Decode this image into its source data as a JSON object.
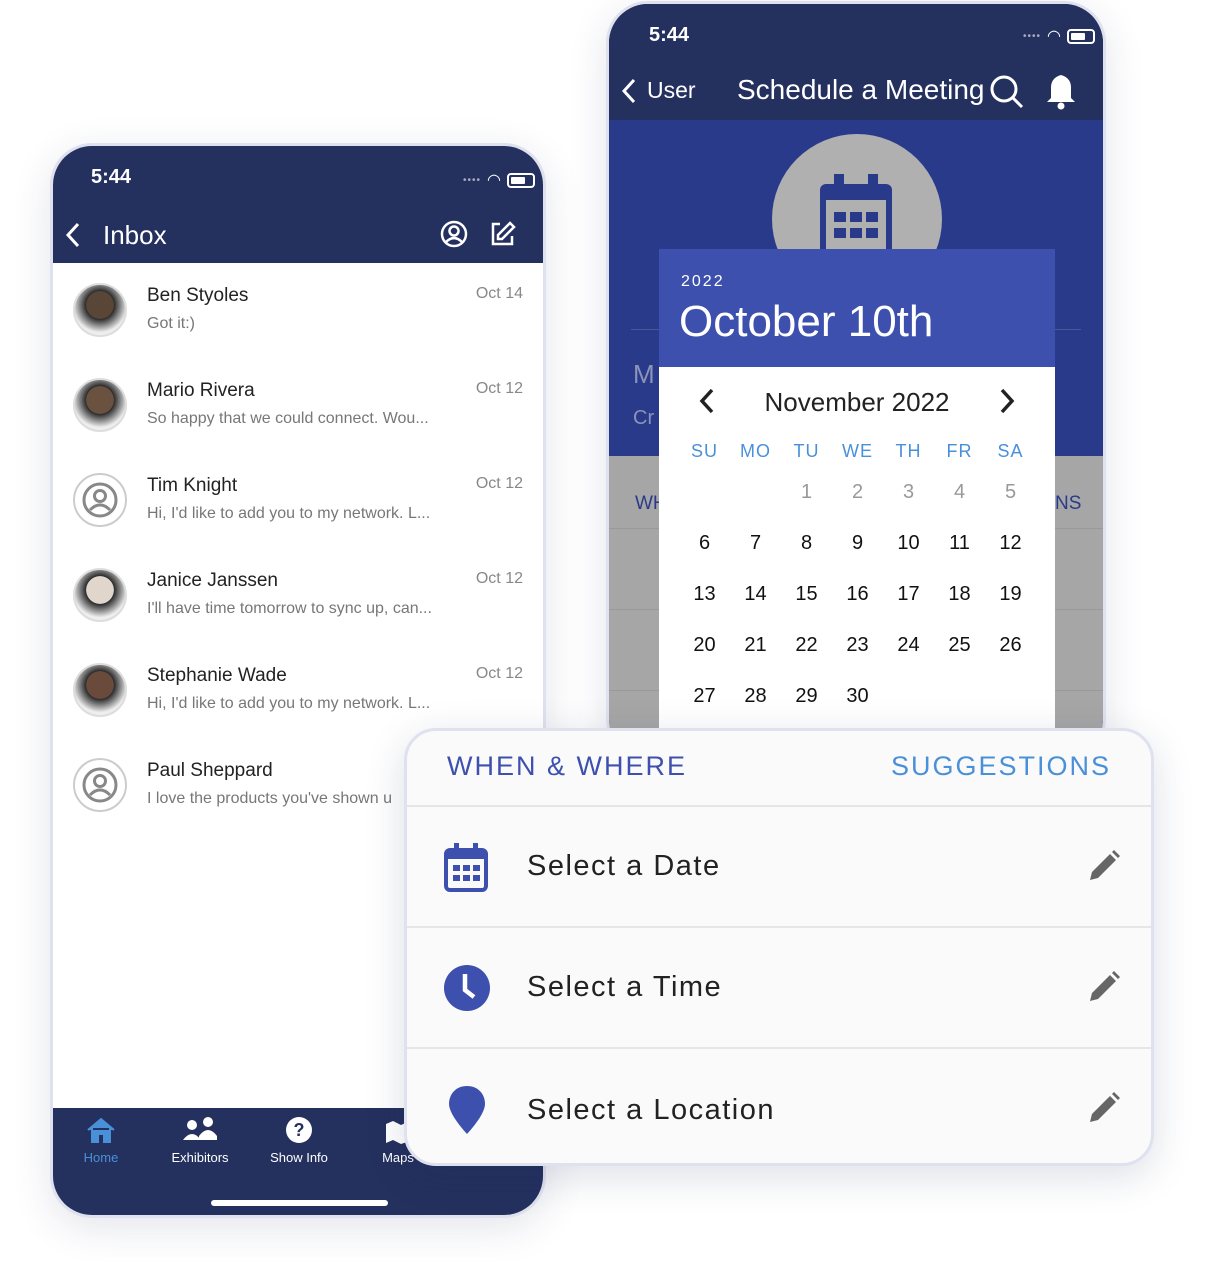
{
  "inbox": {
    "status_time": "5:44",
    "title": "Inbox",
    "messages": [
      {
        "name": "Ben Styoles",
        "preview": "Got it:)",
        "date": "Oct 14"
      },
      {
        "name": "Mario Rivera",
        "preview": "So happy that we could connect. Wou...",
        "date": "Oct 12"
      },
      {
        "name": "Tim Knight",
        "preview": "Hi, I'd like to add you to my network. L...",
        "date": "Oct 12"
      },
      {
        "name": "Janice Janssen",
        "preview": "I'll have time tomorrow to sync up, can...",
        "date": "Oct 12"
      },
      {
        "name": "Stephanie Wade",
        "preview": "Hi, I'd like to add you to my network. L...",
        "date": "Oct 12"
      },
      {
        "name": "Paul Sheppard",
        "preview": "I love the products you've shown u",
        "date": ""
      }
    ],
    "tabs": [
      {
        "label": "Home",
        "active": true
      },
      {
        "label": "Exhibitors"
      },
      {
        "label": "Show Info"
      },
      {
        "label": "Maps"
      }
    ]
  },
  "schedule": {
    "status_time": "5:44",
    "back_label": "User",
    "title": "Schedule a Meeting",
    "partial_text": [
      "M",
      "Cr",
      "WH",
      "NS"
    ],
    "picker": {
      "year": "2022",
      "selected_date": "October 10th",
      "month": "November 2022",
      "weekdays": [
        "SU",
        "MO",
        "TU",
        "WE",
        "TH",
        "FR",
        "SA"
      ],
      "days": [
        "",
        "",
        "1",
        "2",
        "3",
        "4",
        "5",
        "6",
        "7",
        "8",
        "9",
        "10",
        "11",
        "12",
        "13",
        "14",
        "15",
        "16",
        "17",
        "18",
        "19",
        "20",
        "21",
        "22",
        "23",
        "24",
        "25",
        "26",
        "27",
        "28",
        "29",
        "30"
      ]
    }
  },
  "card": {
    "tab_when": "WHEN & WHERE",
    "tab_suggestions": "SUGGESTIONS",
    "rows": [
      {
        "label": "Select a Date",
        "icon": "calendar-icon"
      },
      {
        "label": "Select a Time",
        "icon": "clock-icon"
      },
      {
        "label": "Select a Location",
        "icon": "map-pin-icon"
      }
    ]
  },
  "colors": {
    "navy": "#24305e",
    "accent": "#3d50ad",
    "light_blue": "#4a90d9"
  }
}
